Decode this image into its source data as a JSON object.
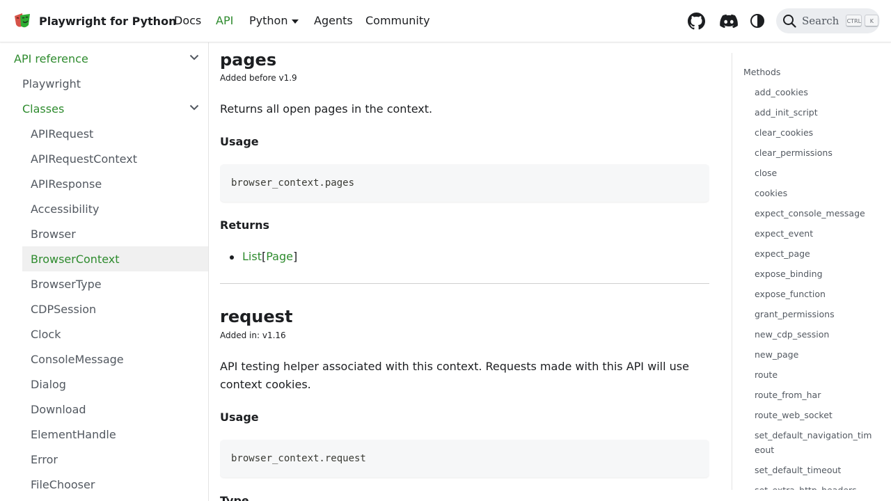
{
  "navbar": {
    "brand_title": "Playwright for Python",
    "links": {
      "docs": "Docs",
      "api": "API",
      "python": "Python",
      "agents": "Agents",
      "community": "Community"
    },
    "search_label": "Search",
    "shortcut_keys": [
      "CTRL",
      "K"
    ],
    "icons": [
      "github-icon",
      "discord-icon",
      "theme-toggle-icon",
      "search-icon"
    ],
    "accent_color": "#2e8b2e"
  },
  "sidebar": {
    "section": "API reference",
    "playwright": "Playwright",
    "classes": "Classes",
    "items": [
      "APIRequest",
      "APIRequestContext",
      "APIResponse",
      "Accessibility",
      "Browser",
      "BrowserContext",
      "BrowserType",
      "CDPSession",
      "Clock",
      "ConsoleMessage",
      "Dialog",
      "Download",
      "ElementHandle",
      "Error",
      "FileChooser"
    ],
    "active_item": "BrowserContext"
  },
  "main": {
    "pages": {
      "title": "pages",
      "added": "Added before v1.9",
      "description": "Returns all open pages in the context.",
      "usage_label": "Usage",
      "code": "browser_context.pages",
      "returns_label": "Returns",
      "return_type": {
        "list": "List",
        "open": "[",
        "page": "Page",
        "close": "]"
      }
    },
    "request": {
      "title": "request",
      "added": "Added in: v1.16",
      "description": "API testing helper associated with this context. Requests made with this API will use context cookies.",
      "usage_label": "Usage",
      "code": "browser_context.request",
      "type_label": "Type"
    }
  },
  "toc": {
    "title": "Methods",
    "items": [
      "add_cookies",
      "add_init_script",
      "clear_cookies",
      "clear_permissions",
      "close",
      "cookies",
      "expect_console_message",
      "expect_event",
      "expect_page",
      "expose_binding",
      "expose_function",
      "grant_permissions",
      "new_cdp_session",
      "new_page",
      "route",
      "route_from_har",
      "route_web_socket",
      "set_default_navigation_timeout",
      "set_default_timeout",
      "set_extra_http_headers"
    ]
  }
}
